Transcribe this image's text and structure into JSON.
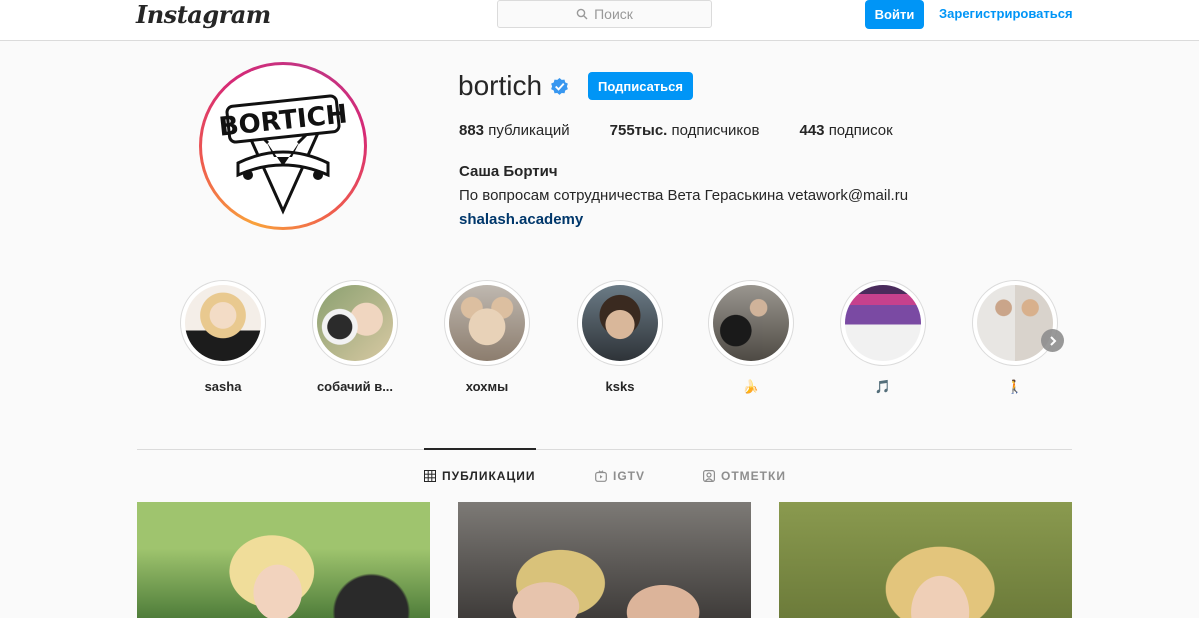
{
  "header": {
    "logo": "Instagram",
    "search_placeholder": "Поиск",
    "login_label": "Войти",
    "signup_label": "Зарегистрироваться"
  },
  "profile": {
    "username": "bortich",
    "follow_label": "Подписаться",
    "stats": [
      {
        "num": "883",
        "label": "публикаций"
      },
      {
        "num": "755тыс.",
        "label": "подписчиков"
      },
      {
        "num": "443",
        "label": "подписок"
      }
    ],
    "full_name": "Саша Бортич",
    "bio": "По вопросам сотрудничества Вета Гераськина vetawork@mail.ru",
    "website": "shalash.academy",
    "avatar_text": "BORTICH"
  },
  "highlights": [
    {
      "label": "sasha"
    },
    {
      "label": "собачий в..."
    },
    {
      "label": "хохмы"
    },
    {
      "label": "ksks"
    },
    {
      "label": "🍌"
    },
    {
      "label": "🎵"
    },
    {
      "label": "🚶"
    }
  ],
  "tabs": [
    {
      "label": "ПУБЛИКАЦИИ"
    },
    {
      "label": "IGTV"
    },
    {
      "label": "ОТМЕТКИ"
    }
  ],
  "colors": {
    "accent": "#0095f6",
    "link": "#00376b",
    "background": "#fafafa"
  }
}
